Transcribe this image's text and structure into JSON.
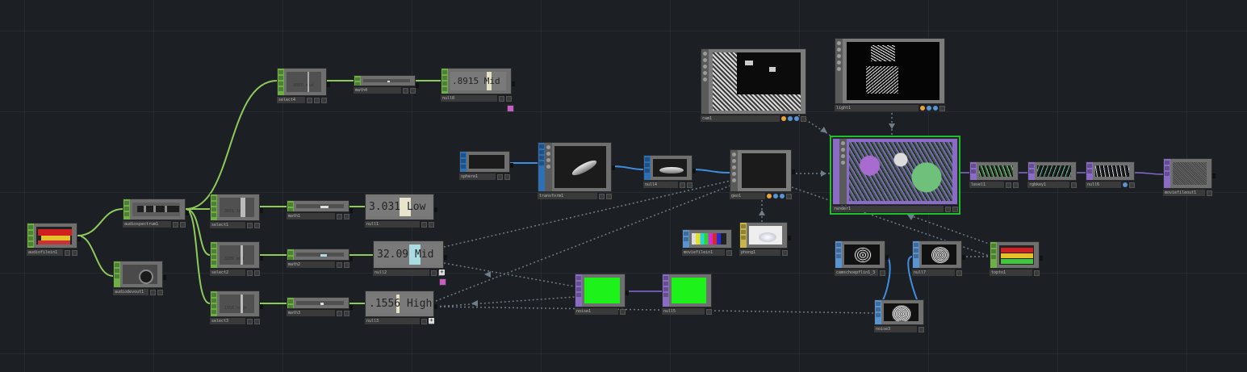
{
  "nodes": {
    "audiofilein1": "audiofilein1",
    "audiodevout1": "audiodevout1",
    "audiospectrum1": "audiospectrum1",
    "select4": "select4",
    "select1": "select1",
    "select2": "select2",
    "select3": "select3",
    "math4": "math4",
    "math1": "math1",
    "math2": "math2",
    "math3": "math3",
    "null8": "null8",
    "null1": "null1",
    "null2": "null2",
    "null3": "null3",
    "sphere1": "sphere1",
    "transform1": "transform1",
    "null4": "null4",
    "geo1": "geo1",
    "cam1": "cam1",
    "light1": "light1",
    "render1": "render1",
    "level1": "level1",
    "rgbkey1": "rgbkey1",
    "null6": "null6",
    "moviefileout1": "moviefileout1",
    "moviefilein1": "moviefilein1",
    "phong1": "phong1",
    "noise1": "noise1",
    "null5": "null5",
    "constant1_3": "camschoepflin1_3",
    "null7": "null7",
    "noise3": "noise3",
    "topto1": "topto1"
  },
  "values": {
    "mid_top": ".8915 Mid",
    "low": "3.031 Low",
    "mid": "32.09 Mid",
    "high": ".1556 High",
    "sel4_small": ".8915  mid",
    "sel1_small": "3031   low",
    "sel2_small": "3209   mid",
    "sel3_small": "1556   high"
  },
  "plus": "+",
  "colors": {
    "chop": "#6cb046",
    "top": "#5a93d1",
    "sop": "#2f6fb6",
    "comp": "#8a6cc7",
    "mat": "#c9b649",
    "wire_chop": "#8ecb5a",
    "wire_sop": "#3f8fe0",
    "wire_top": "#8a6cd6",
    "selected": "#1fbf2a",
    "noise_green": "#1df21a"
  }
}
